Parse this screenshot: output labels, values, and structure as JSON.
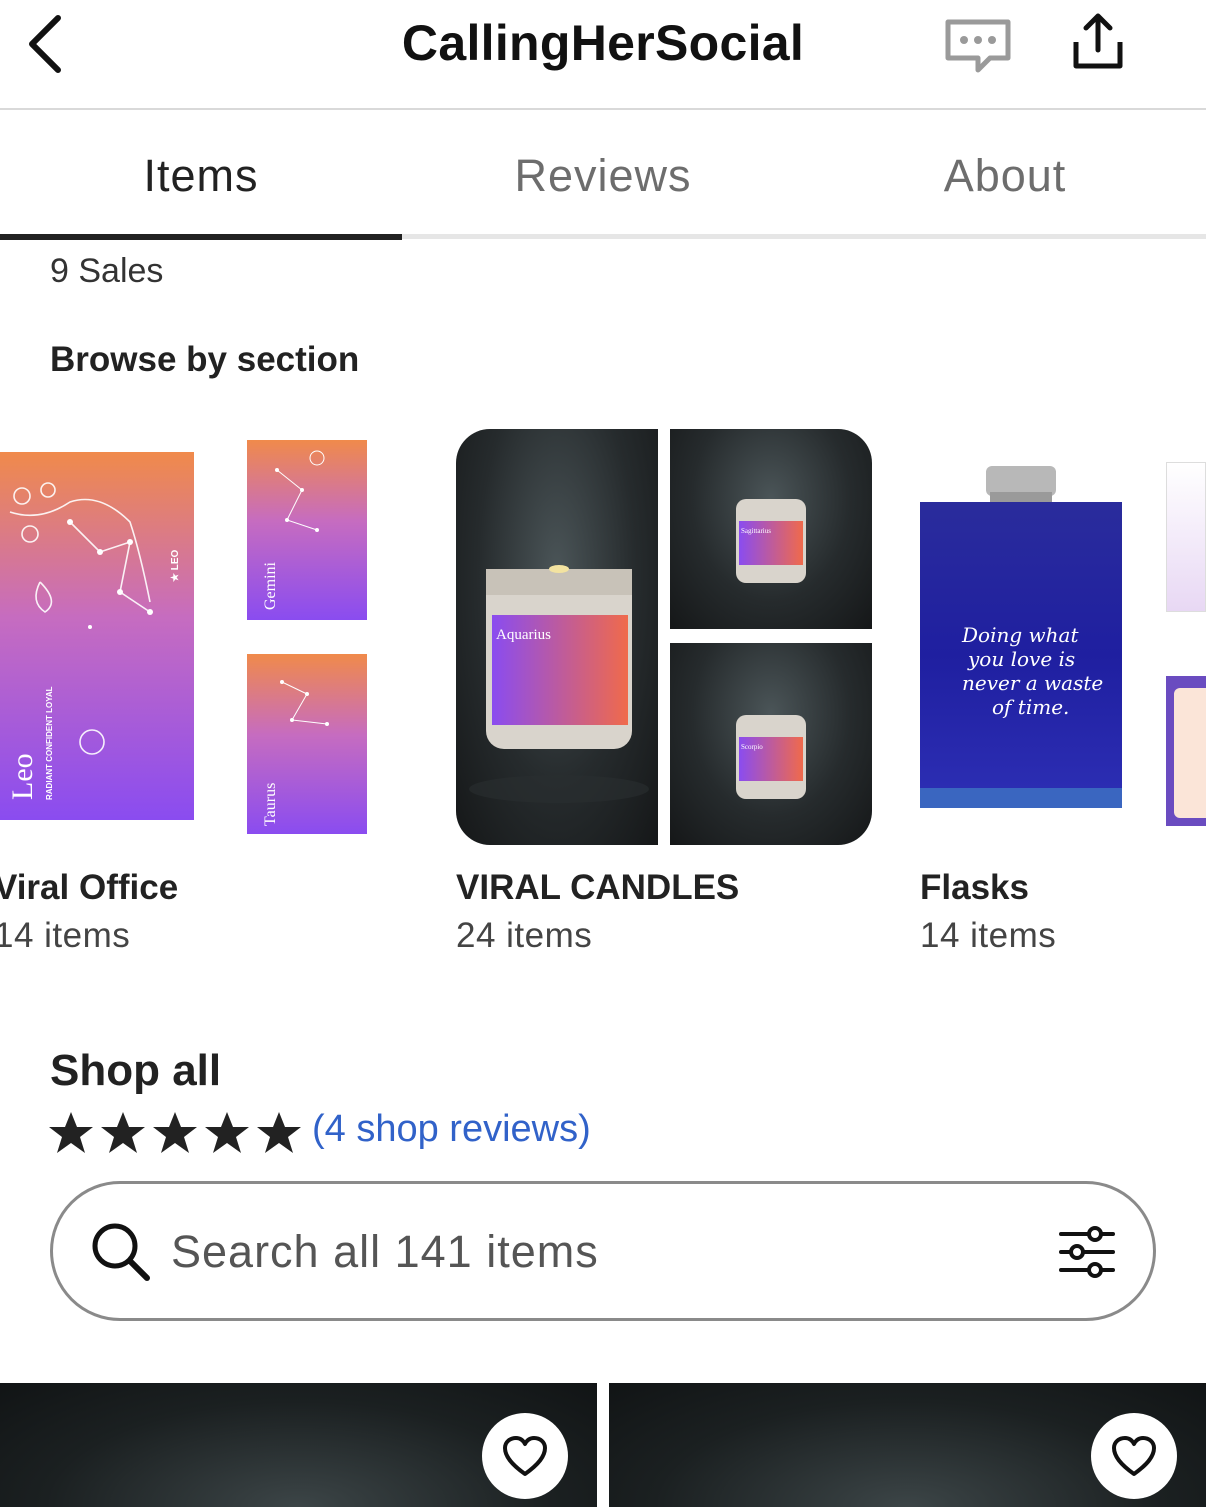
{
  "header": {
    "shop_name": "CallingHerSocial",
    "back_icon": "chevron-left-icon",
    "message_icon": "message-icon",
    "share_icon": "share-icon"
  },
  "tabs": [
    {
      "label": "Items",
      "active": true
    },
    {
      "label": "Reviews",
      "active": false
    },
    {
      "label": "About",
      "active": false
    }
  ],
  "shop_stats": {
    "sales": "9 Sales"
  },
  "browse": {
    "heading": "Browse by section",
    "sections": [
      {
        "title": "Viral Office",
        "count": "14 items"
      },
      {
        "title": "VIRAL CANDLES",
        "count": "24 items"
      },
      {
        "title": "Flasks",
        "count": "14 items"
      }
    ]
  },
  "product_art": {
    "office_main_sign": "Leo",
    "office_main_traits": "RADIANT  CONFIDENT  LOYAL",
    "office_main_badge": "★ LEO",
    "office_small_1": "Gemini",
    "office_small_2": "Taurus",
    "candle_main_label": "Aquarius",
    "candle_small_1_label": "Sagittarius",
    "candle_small_2_label": "Scorpio",
    "flask_text_lines": [
      "Doing what",
      "you love is",
      "never a waste",
      "of time."
    ]
  },
  "shop_all": {
    "heading": "Shop all",
    "rating_stars": 5,
    "reviews_link": "(4 shop reviews)"
  },
  "search": {
    "placeholder": "Search all 141 items",
    "filter_icon": "filter-sliders-icon"
  },
  "colors": {
    "accent_link": "#3162c9",
    "tab_indicator": "#222222",
    "text_primary": "#222222"
  }
}
